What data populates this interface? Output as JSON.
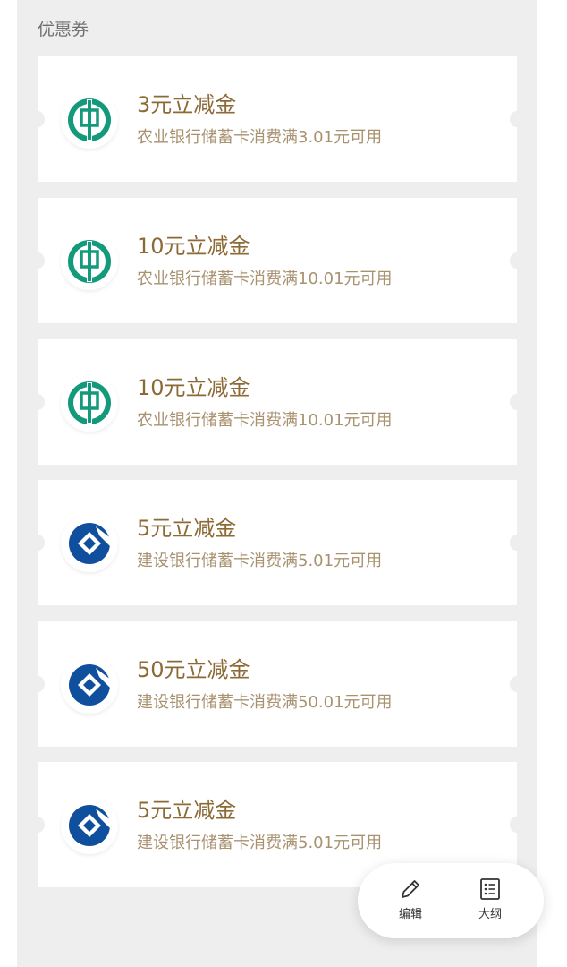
{
  "section": {
    "title": "优惠券"
  },
  "coupons": [
    {
      "bank": "abc",
      "bank_icon": "abc-bank-logo-icon",
      "title": "3元立减金",
      "desc": "农业银行储蓄卡消费满3.01元可用"
    },
    {
      "bank": "abc",
      "bank_icon": "abc-bank-logo-icon",
      "title": "10元立减金",
      "desc": "农业银行储蓄卡消费满10.01元可用"
    },
    {
      "bank": "abc",
      "bank_icon": "abc-bank-logo-icon",
      "title": "10元立减金",
      "desc": "农业银行储蓄卡消费满10.01元可用"
    },
    {
      "bank": "ccb",
      "bank_icon": "ccb-bank-logo-icon",
      "title": "5元立减金",
      "desc": "建设银行储蓄卡消费满5.01元可用"
    },
    {
      "bank": "ccb",
      "bank_icon": "ccb-bank-logo-icon",
      "title": "50元立减金",
      "desc": "建设银行储蓄卡消费满50.01元可用"
    },
    {
      "bank": "ccb",
      "bank_icon": "ccb-bank-logo-icon",
      "title": "5元立减金",
      "desc": "建设银行储蓄卡消费满5.01元可用"
    }
  ],
  "fab": {
    "edit_label": "编辑",
    "edit_icon": "pencil-icon",
    "outline_label": "大纲",
    "outline_icon": "outline-list-icon"
  },
  "colors": {
    "panel_bg": "#efeeef",
    "coupon_title": "#8c6a36",
    "coupon_desc": "#a89270",
    "abc_green": "#139a7a",
    "ccb_blue": "#0f4f9e"
  }
}
